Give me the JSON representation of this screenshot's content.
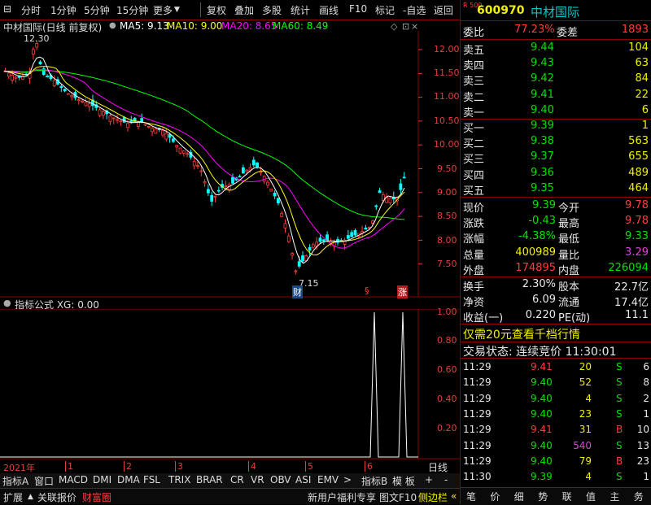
{
  "toolbar": {
    "left": [
      "分时",
      "1分钟",
      "5分钟",
      "15分钟",
      "更多"
    ],
    "right": [
      "复权",
      "叠加",
      "多股",
      "统计",
      "画线",
      "F10",
      "标记",
      "-自选",
      "返回"
    ]
  },
  "chart": {
    "title": "中材国际(日线 前复权)",
    "ma5": "MA5: 9.13",
    "ma10": "MA10: 9.00",
    "ma20": "MA20: 8.65",
    "ma60": "MA60: 8.49",
    "high_label": "12.30",
    "low_label": "7.15",
    "price_ticks": [
      "12.00",
      "11.50",
      "11.00",
      "10.50",
      "10.00",
      "9.50",
      "9.00",
      "8.50",
      "8.00",
      "7.50"
    ],
    "markers": {
      "cai": "财",
      "s": "§",
      "zhang": "涨"
    },
    "colors": {
      "ma5": "#ffffff",
      "ma10": "#ffff00",
      "ma20": "#ff00ff",
      "ma60": "#00ff00",
      "up": "#ff3c3c",
      "down": "#00ffff"
    }
  },
  "indicator": {
    "title": "指标公式 XG: 0.00",
    "ticks": [
      "1.00",
      "0.80",
      "0.60",
      "0.40",
      "0.20"
    ]
  },
  "axis": {
    "year": "2021年",
    "months": [
      "1",
      "2",
      "3",
      "4",
      "5",
      "6"
    ],
    "period": "日线"
  },
  "tabs1": [
    "指标A",
    "窗口",
    "MACD",
    "DMI",
    "DMA",
    "FSL",
    "TRIX",
    "BRAR",
    "CR",
    "VR",
    "OBV",
    "ASI",
    "EMV",
    "指标B",
    "模 板"
  ],
  "tabs2": [
    "扩展",
    "关联报价",
    "财富圈"
  ],
  "bottom_right": [
    "新用户福利专享",
    "图文F10",
    "侧边栏"
  ],
  "stock": {
    "code": "600970",
    "name": "中材国际",
    "badge": "R 500"
  },
  "committee": {
    "ratio_label": "委比",
    "ratio": "77.23%",
    "diff_label": "委差",
    "diff": "1893"
  },
  "sell": [
    {
      "label": "卖五",
      "price": "9.44",
      "vol": "104"
    },
    {
      "label": "卖四",
      "price": "9.43",
      "vol": "63"
    },
    {
      "label": "卖三",
      "price": "9.42",
      "vol": "84"
    },
    {
      "label": "卖二",
      "price": "9.41",
      "vol": "22"
    },
    {
      "label": "卖一",
      "price": "9.40",
      "vol": "6"
    }
  ],
  "buy": [
    {
      "label": "买一",
      "price": "9.39",
      "vol": "1"
    },
    {
      "label": "买二",
      "price": "9.38",
      "vol": "563"
    },
    {
      "label": "买三",
      "price": "9.37",
      "vol": "655"
    },
    {
      "label": "买四",
      "price": "9.36",
      "vol": "489"
    },
    {
      "label": "买五",
      "price": "9.35",
      "vol": "464"
    }
  ],
  "quote": [
    {
      "l1": "现价",
      "v1": "9.39",
      "l2": "今开",
      "v2": "9.78"
    },
    {
      "l1": "涨跌",
      "v1": "-0.43",
      "l2": "最高",
      "v2": "9.78"
    },
    {
      "l1": "涨幅",
      "v1": "-4.38%",
      "l2": "最低",
      "v2": "9.33"
    },
    {
      "l1": "总量",
      "v1": "400989",
      "l2": "量比",
      "v2": "3.29"
    },
    {
      "l1": "外盘",
      "v1": "174895",
      "l2": "内盘",
      "v2": "226094"
    }
  ],
  "stats": [
    {
      "l1": "换手",
      "v1": "2.30%",
      "l2": "股本",
      "v2": "22.7亿"
    },
    {
      "l1": "净资",
      "v1": "6.09",
      "l2": "流通",
      "v2": "17.4亿"
    },
    {
      "l1": "收益(一)",
      "v1": "0.220",
      "l2": "PE(动)",
      "v2": "11.1"
    }
  ],
  "promo": "仅需20元查看千档行情",
  "trade_status": "交易状态: 连续竞价 11:30:01",
  "ticks": [
    {
      "t": "11:29",
      "p": "9.41",
      "v": "20",
      "d": "S",
      "n": "6"
    },
    {
      "t": "11:29",
      "p": "9.40",
      "v": "52",
      "d": "S",
      "n": "8"
    },
    {
      "t": "11:29",
      "p": "9.40",
      "v": "4",
      "d": "S",
      "n": "2"
    },
    {
      "t": "11:29",
      "p": "9.40",
      "v": "23",
      "d": "S",
      "n": "1"
    },
    {
      "t": "11:29",
      "p": "9.41",
      "v": "31",
      "d": "B",
      "n": "10"
    },
    {
      "t": "11:29",
      "p": "9.40",
      "v": "540",
      "d": "S",
      "n": "13"
    },
    {
      "t": "11:29",
      "p": "9.40",
      "v": "79",
      "d": "B",
      "n": "23"
    },
    {
      "t": "11:30",
      "p": "9.39",
      "v": "4",
      "d": "S",
      "n": "1"
    }
  ],
  "nav": [
    "笔",
    "价",
    "细",
    "势",
    "联",
    "值",
    "主",
    "务"
  ]
}
